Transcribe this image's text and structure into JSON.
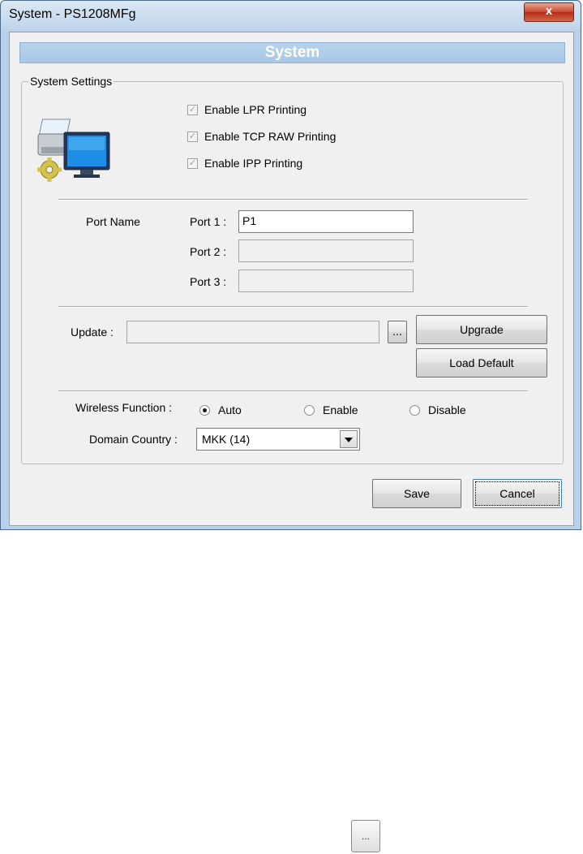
{
  "window": {
    "title": "System - PS1208MFg",
    "close_label": "x"
  },
  "banner": {
    "title": "System"
  },
  "system_settings": {
    "legend": "System Settings",
    "options": [
      {
        "label": "Enable LPR Printing",
        "checked": true,
        "disabled": true
      },
      {
        "label": "Enable TCP RAW Printing",
        "checked": true,
        "disabled": true
      },
      {
        "label": "Enable IPP Printing",
        "checked": true,
        "disabled": true
      }
    ],
    "check_mark": "✓"
  },
  "ports": {
    "section_label": "Port Name",
    "items": [
      {
        "label": "Port 1 :",
        "value": "P1",
        "enabled": true
      },
      {
        "label": "Port 2 :",
        "value": "",
        "enabled": false
      },
      {
        "label": "Port 3 :",
        "value": "",
        "enabled": false
      }
    ]
  },
  "update": {
    "label": "Update :",
    "value": "",
    "browse_label": "...",
    "upgrade_label": "Upgrade",
    "load_default_label": "Load Default"
  },
  "wireless": {
    "label": "Wireless Function :",
    "options": [
      {
        "label": "Auto",
        "selected": true
      },
      {
        "label": "Enable",
        "selected": false
      },
      {
        "label": "Disable",
        "selected": false
      }
    ]
  },
  "domain": {
    "label": "Domain Country :",
    "selected": "MKK (14)"
  },
  "footer": {
    "save_label": "Save",
    "cancel_label": "Cancel"
  },
  "extra": {
    "browse_button_label": "..."
  },
  "colors": {
    "banner": "#b0cce8",
    "window_frame": "#b9d1ea",
    "client_bg": "#f0f0f0",
    "close": "#c9462c"
  },
  "icons": {
    "app_icon": "printer-monitor-gear-icon",
    "dropdown": "chevron-down-icon",
    "close": "close-icon"
  }
}
